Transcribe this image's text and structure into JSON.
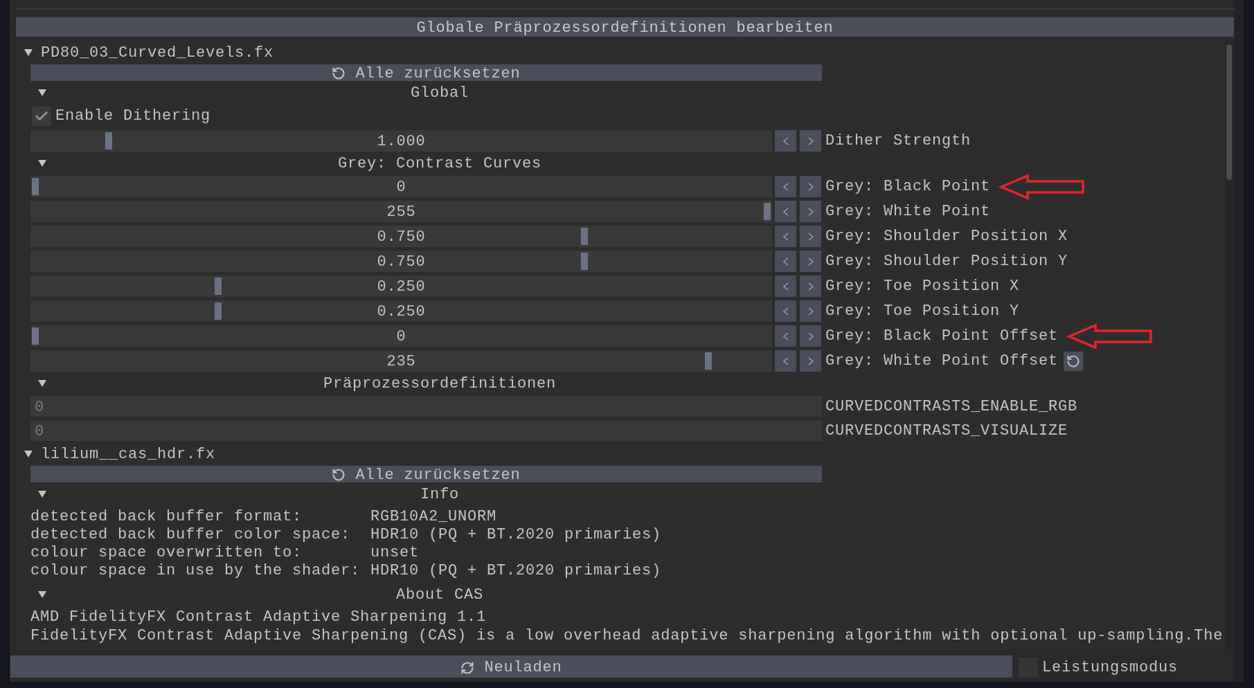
{
  "window": {
    "title": "Globale Präprozessordefinitionen bearbeiten"
  },
  "effects": [
    {
      "file": "PD80_03_Curved_Levels.fx",
      "expanded": true,
      "reset_label": "Alle zurücksetzen",
      "sections": [
        {
          "title": "Global",
          "expanded": true,
          "items": [
            {
              "kind": "checkbox",
              "label": "Enable Dithering",
              "checked": true
            },
            {
              "kind": "slider",
              "value": "1.000",
              "level": 0.1,
              "label": "Dither Strength",
              "annotated": false,
              "modified": false
            }
          ]
        },
        {
          "title": "Grey: Contrast Curves",
          "expanded": true,
          "items": [
            {
              "kind": "slider",
              "value": "0",
              "level": 0,
              "label": "Grey: Black Point",
              "annotated": true,
              "modified": false
            },
            {
              "kind": "slider",
              "value": "255",
              "level": 1,
              "label": "Grey: White Point",
              "annotated": false,
              "modified": false
            },
            {
              "kind": "slider",
              "value": "0.750",
              "level": 0.75,
              "label": "Grey: Shoulder Position X",
              "annotated": false,
              "modified": false
            },
            {
              "kind": "slider",
              "value": "0.750",
              "level": 0.75,
              "label": "Grey: Shoulder Position Y",
              "annotated": false,
              "modified": false
            },
            {
              "kind": "slider",
              "value": "0.250",
              "level": 0.25,
              "label": "Grey: Toe Position X",
              "annotated": false,
              "modified": false
            },
            {
              "kind": "slider",
              "value": "0.250",
              "level": 0.25,
              "label": "Grey: Toe Position Y",
              "annotated": false,
              "modified": false
            },
            {
              "kind": "slider",
              "value": "0",
              "level": 0,
              "label": "Grey: Black Point Offset",
              "annotated": true,
              "modified": false
            },
            {
              "kind": "slider",
              "value": "235",
              "level": 0.92,
              "label": "Grey: White Point Offset",
              "annotated": false,
              "modified": true
            }
          ]
        },
        {
          "title": "Präprozessordefinitionen",
          "expanded": true,
          "items": [
            {
              "kind": "define",
              "placeholder": "0",
              "label": "CURVEDCONTRASTS_ENABLE_RGB"
            },
            {
              "kind": "define",
              "placeholder": "0",
              "label": "CURVEDCONTRASTS_VISUALIZE"
            }
          ]
        }
      ]
    },
    {
      "file": "lilium__cas_hdr.fx",
      "expanded": true,
      "reset_label": "Alle zurücksetzen",
      "sections": [
        {
          "title": "Info",
          "expanded": true,
          "items": [
            {
              "kind": "info",
              "label": "detected back buffer format:",
              "value": "RGB10A2_UNORM"
            },
            {
              "kind": "info",
              "label": "detected back buffer color space:",
              "value": "HDR10 (PQ + BT.2020 primaries)"
            },
            {
              "kind": "info",
              "label": "colour space overwritten to:",
              "value": "unset"
            },
            {
              "kind": "info",
              "label": "colour space in use by the shader:",
              "value": "HDR10 (PQ + BT.2020 primaries)"
            }
          ]
        },
        {
          "title": "About CAS",
          "expanded": true,
          "items": [
            {
              "kind": "text",
              "text": "AMD FidelityFX Contrast Adaptive Sharpening 1.1"
            },
            {
              "kind": "text",
              "text": "FidelityFX Contrast Adaptive Sharpening (CAS) is a low overhead adaptive sharpening algorithm with optional up-sampling.The"
            }
          ]
        }
      ]
    }
  ],
  "footer": {
    "reload_label": "Neuladen",
    "performance_mode": {
      "label": "Leistungsmodus",
      "checked": false
    }
  }
}
